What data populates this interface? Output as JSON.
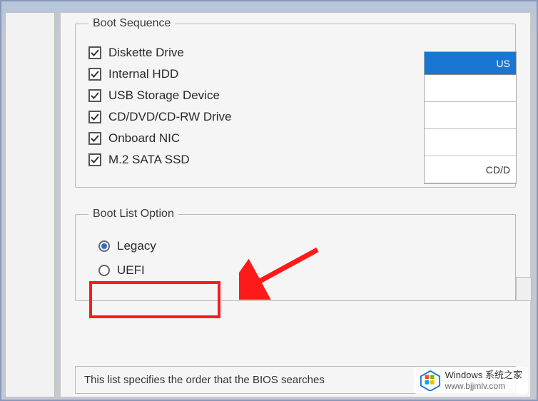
{
  "bootSequence": {
    "legend": "Boot Sequence",
    "items": [
      {
        "label": "Diskette Drive",
        "checked": true
      },
      {
        "label": "Internal HDD",
        "checked": true
      },
      {
        "label": "USB Storage Device",
        "checked": true
      },
      {
        "label": "CD/DVD/CD-RW Drive",
        "checked": true
      },
      {
        "label": "Onboard NIC",
        "checked": true
      },
      {
        "label": "M.2 SATA SSD",
        "checked": true
      }
    ]
  },
  "bootListOption": {
    "legend": "Boot List Option",
    "options": [
      {
        "label": "Legacy",
        "selected": true
      },
      {
        "label": "UEFI",
        "selected": false
      }
    ]
  },
  "sideTable": {
    "header": "US",
    "rows": [
      "",
      "",
      "",
      "CD/D"
    ]
  },
  "description": "This list specifies the order that the BIOS searches",
  "watermark": {
    "title": "Windows 系统之家",
    "url": "www.bjjmlv.com"
  },
  "annotation": {
    "highlightTarget": "UEFI option",
    "arrowColor": "#ff1a1a"
  }
}
